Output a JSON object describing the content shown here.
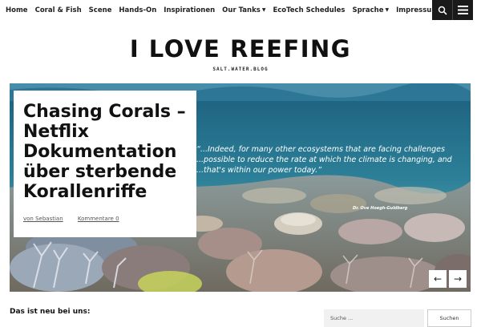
{
  "nav": {
    "items": [
      {
        "label": "Home"
      },
      {
        "label": "Coral & Fish"
      },
      {
        "label": "Scene"
      },
      {
        "label": "Hands-On"
      },
      {
        "label": "Inspirationen"
      },
      {
        "label": "Our Tanks"
      },
      {
        "label": "EcoTech Schedules"
      },
      {
        "label": "Sprache"
      },
      {
        "label": "Impressum"
      }
    ],
    "search_icon": "search-icon",
    "menu_icon": "hamburger-menu-icon"
  },
  "site": {
    "title": "I LOVE REEFING",
    "tagline": "SALT.WATER.BLOG"
  },
  "slider": {
    "quote": "“...Indeed, for many other ecosystems that are facing challenges ...possible to reduce the rate at which the climate is changing, and ...that's within our power today.”",
    "quote_author": "Dr. Ove Hoegh-Guldberg",
    "post": {
      "title": "Chasing Corals – Netflix Dokumentation über sterbende Korallenriffe",
      "author": "von Sebastian",
      "comments": "Kommentare 0"
    },
    "prev_icon": "arrow-left-icon",
    "next_icon": "arrow-right-icon"
  },
  "sidebar": {
    "search_placeholder": "Suche ...",
    "search_button": "Suchen"
  },
  "main": {
    "news_heading": "Das ist neu bei uns:"
  },
  "colors": {
    "nav_dark": "#1a1a1a",
    "text": "#111111",
    "water_top": "#1f6f8c",
    "water_bottom": "#4fa0a8"
  }
}
